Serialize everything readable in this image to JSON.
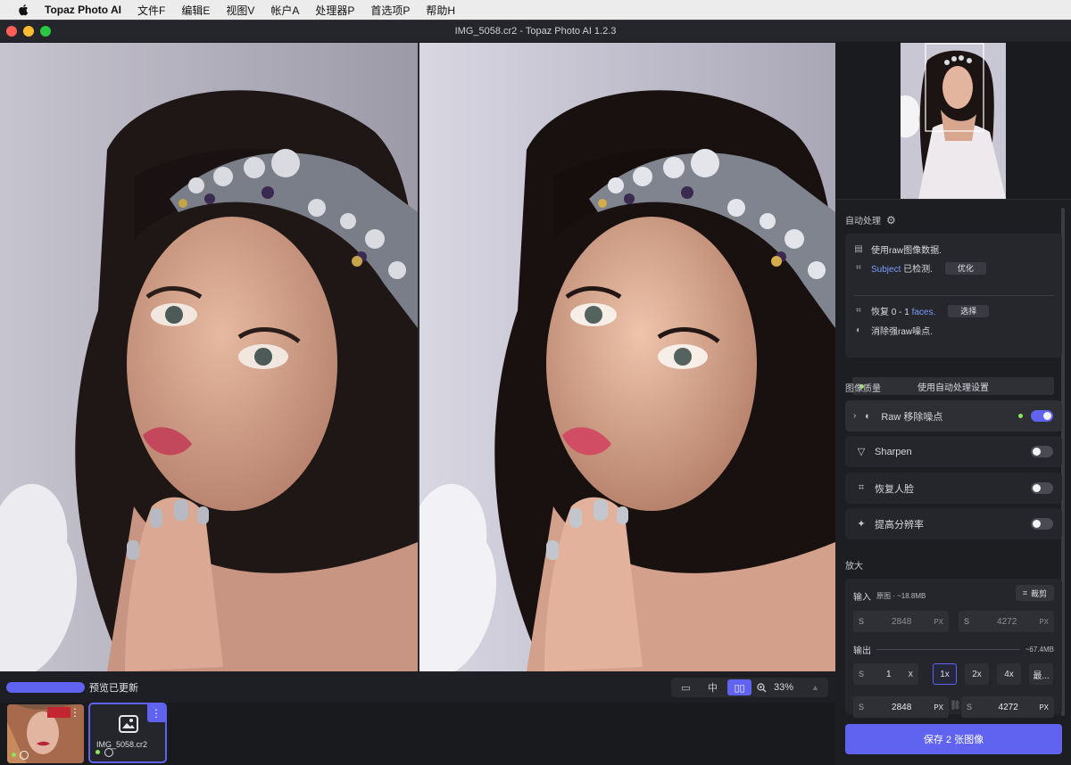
{
  "menubar": {
    "app_name": "Topaz Photo AI",
    "items": [
      "文件F",
      "编辑E",
      "视图V",
      "帐户A",
      "处理器P",
      "首选项P",
      "帮助H"
    ]
  },
  "window": {
    "title": "IMG_5058.cr2 - Topaz Photo AI 1.2.3",
    "traffic_colors": [
      "#ff5f57",
      "#febc2e",
      "#28c840"
    ]
  },
  "status": {
    "preview_text": "预览已更新",
    "zoom": "33%",
    "view_buttons": [
      "▭",
      "中",
      "▯▯"
    ]
  },
  "filmstrip": {
    "items": [
      {
        "name": ""
      },
      {
        "name": "IMG_5058.cr2"
      }
    ]
  },
  "panel": {
    "autopilot": {
      "title": "自动处理",
      "raw_data": "使用raw图像数据.",
      "subject_word": "Subject",
      "subject_suffix": "已检测.",
      "optimize_btn": "优化",
      "faces_prefix": "恢复 0 - 1",
      "faces_word": "faces.",
      "select_btn": "选择",
      "noise_text": "消除强raw噪点.",
      "use_settings_btn": "使用自动处理设置"
    },
    "quality": {
      "title": "图像质量",
      "features": [
        {
          "label": "Raw 移除噪点",
          "on": true,
          "icon": "denoise-icon"
        },
        {
          "label": "Sharpen",
          "on": false,
          "icon": "sharpen-icon"
        },
        {
          "label": "恢复人脸",
          "on": false,
          "icon": "face-icon"
        },
        {
          "label": "提高分辨率",
          "on": false,
          "icon": "sparkle-icon"
        }
      ]
    },
    "upscale": {
      "title": "放大",
      "input_label": "输入",
      "input_info": "原图 · ~18.8MB",
      "crop_btn": "裁剪",
      "input_width": "2848",
      "input_height": "4272",
      "output_label": "输出",
      "output_size": "~67.4MB",
      "scale_value": "1",
      "scale_unit": "X",
      "scale_buttons": [
        "1x",
        "2x",
        "4x",
        "最..."
      ],
      "out_width": "2848",
      "out_height": "4272",
      "px": "PX",
      "s_label": "S"
    },
    "save_btn": "保存 2 张图像"
  }
}
